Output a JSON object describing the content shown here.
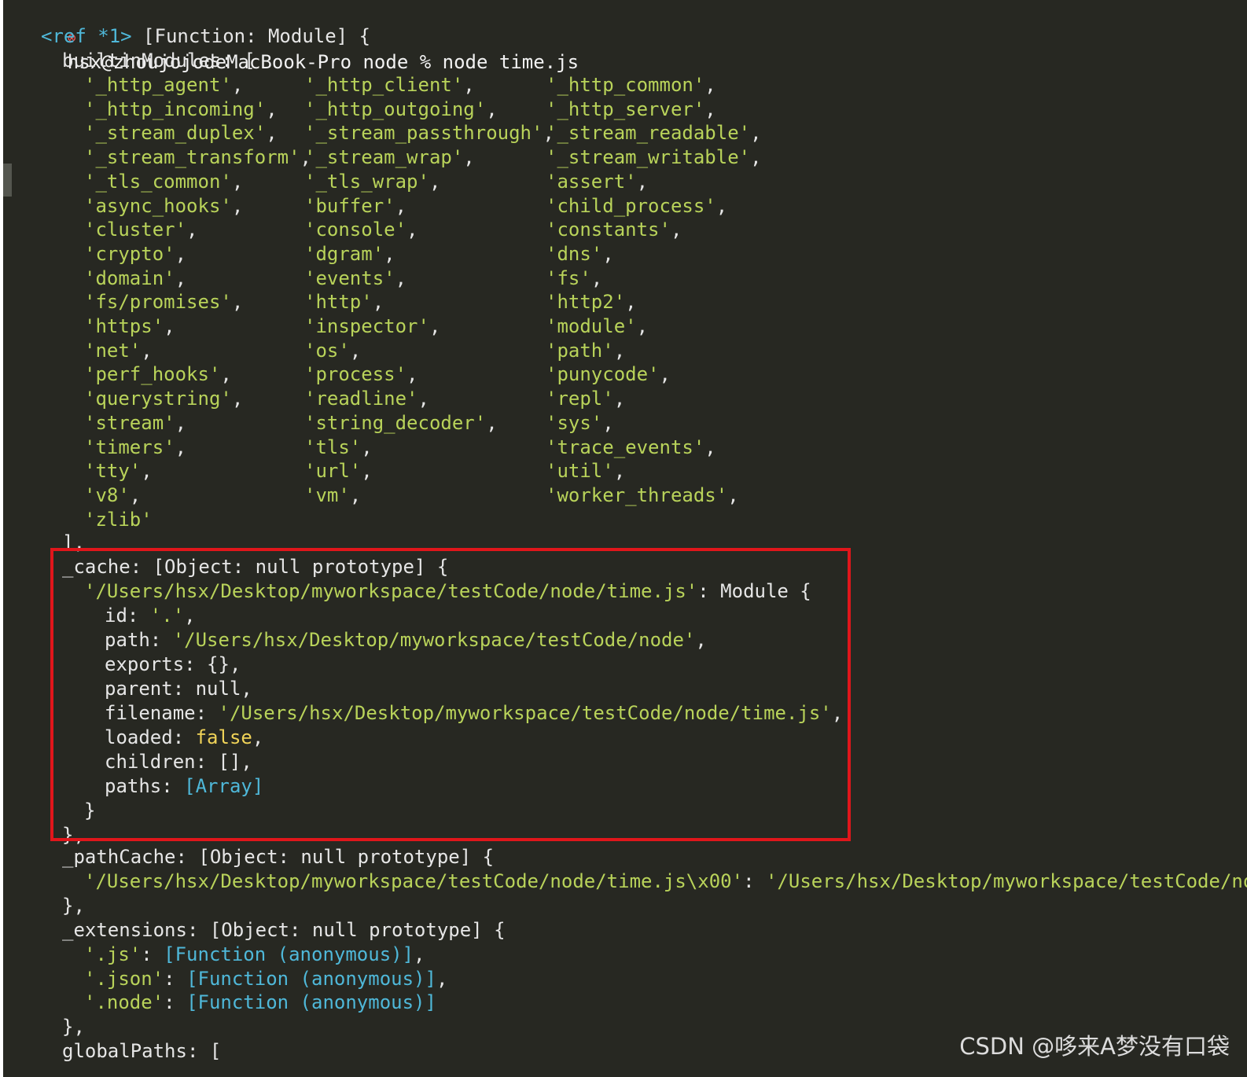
{
  "terminal": {
    "prompt": {
      "error_icon": "⊗",
      "text": "hsx@zhoujojodeMacBook-Pro node % node time.js"
    },
    "ref_tag": "<ref *1>",
    "header": " [Function: Module] {",
    "builtin_open": "builtinModules: [",
    "builtin_modules": [
      [
        "'_http_agent',",
        "'_http_client',",
        "'_http_common',"
      ],
      [
        "'_http_incoming',",
        "'_http_outgoing',",
        "'_http_server',"
      ],
      [
        "'_stream_duplex',",
        "'_stream_passthrough',",
        "'_stream_readable',"
      ],
      [
        "'_stream_transform',",
        "'_stream_wrap',",
        "'_stream_writable',"
      ],
      [
        "'_tls_common',",
        "'_tls_wrap',",
        "'assert',"
      ],
      [
        "'async_hooks',",
        "'buffer',",
        "'child_process',"
      ],
      [
        "'cluster',",
        "'console',",
        "'constants',"
      ],
      [
        "'crypto',",
        "'dgram',",
        "'dns',"
      ],
      [
        "'domain',",
        "'events',",
        "'fs',"
      ],
      [
        "'fs/promises',",
        "'http',",
        "'http2',"
      ],
      [
        "'https',",
        "'inspector',",
        "'module',"
      ],
      [
        "'net',",
        "'os',",
        "'path',"
      ],
      [
        "'perf_hooks',",
        "'process',",
        "'punycode',"
      ],
      [
        "'querystring',",
        "'readline',",
        "'repl',"
      ],
      [
        "'stream',",
        "'string_decoder',",
        "'sys',"
      ],
      [
        "'timers',",
        "'tls',",
        "'trace_events',"
      ],
      [
        "'tty',",
        "'url',",
        "'util',"
      ],
      [
        "'v8',",
        "'vm',",
        "'worker_threads',"
      ],
      [
        "'zlib'",
        "",
        ""
      ]
    ],
    "builtin_close": "],",
    "cache": {
      "open": "_cache: [Object: null prototype] {",
      "module_key": "'/Users/hsx/Desktop/myworkspace/testCode/node/time.js'",
      "module_suffix": ": Module {",
      "id_key": "id: ",
      "id_value": "'.'",
      "path_key": "path: ",
      "path_value": "'/Users/hsx/Desktop/myworkspace/testCode/node'",
      "exports_line": "exports: {},",
      "parent_line": "parent: null,",
      "filename_key": "filename: ",
      "filename_value": "'/Users/hsx/Desktop/myworkspace/testCode/node/time.js'",
      "loaded_key": "loaded: ",
      "loaded_value": "false",
      "children_key": "children: ",
      "children_value": "[]",
      "paths_key": "paths: ",
      "paths_value": "[Array]",
      "inner_close": "}",
      "close": "},"
    },
    "path_cache": {
      "open": "_pathCache: [Object: null prototype] {",
      "key": "'/Users/hsx/Desktop/myworkspace/testCode/node/time.js\\x00'",
      "sep": ": ",
      "value": "'/Users/hsx/Desktop/myworkspace/testCode/node/time.js'",
      "close": "},"
    },
    "extensions": {
      "open": "_extensions: [Object: null prototype] {",
      "items": [
        {
          "key": "'.js'",
          "colon": ": ",
          "value": "[Function (anonymous)]",
          "tail": ","
        },
        {
          "key": "'.json'",
          "colon": ": ",
          "value": "[Function (anonymous)]",
          "tail": ","
        },
        {
          "key": "'.node'",
          "colon": ": ",
          "value": "[Function (anonymous)]",
          "tail": ""
        }
      ],
      "close": "},"
    },
    "global_paths_open": "globalPaths: ["
  },
  "watermark": "CSDN @哆来A梦没有口袋",
  "colors": {
    "background": "#272822",
    "string": "#b9d35a",
    "special": "#4fb8d9",
    "boolean": "#f0d358",
    "highlight_border": "#e0161b"
  }
}
